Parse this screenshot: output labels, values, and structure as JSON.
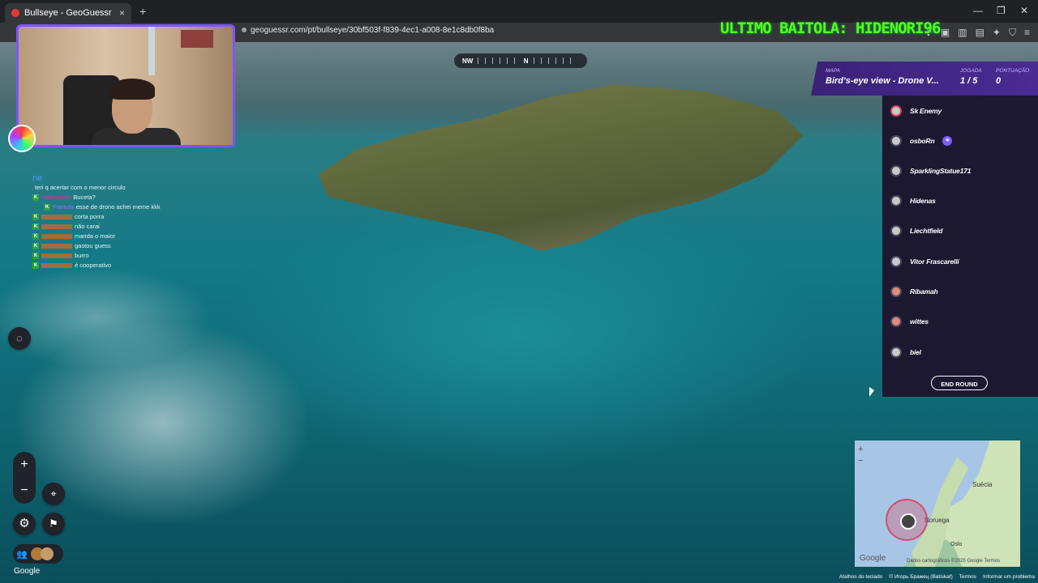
{
  "browser": {
    "tab_title": "Bullseye - GeoGuessr",
    "new_tab": "+",
    "url": "geoguessr.com/pt/bullseye/30bf503f-f839-4ec1-a008-8e1c8db0f8ba"
  },
  "banner": "ULTIMO BAITOLA: HIDENORI96",
  "compass": {
    "left": "NW",
    "center": "N"
  },
  "chat": {
    "header": "ne",
    "messages": [
      {
        "user": "",
        "text": "teri q acertar com o menor circulo"
      },
      {
        "user": "Hidenori96",
        "text": "Buceta?"
      },
      {
        "user": "Pantufa",
        "text": "esse de drono achei meme kkk"
      },
      {
        "user": "",
        "text": "corta porra"
      },
      {
        "user": "",
        "text": "não carai"
      },
      {
        "user": "",
        "text": "manda o maior"
      },
      {
        "user": "",
        "text": "gastou guess"
      },
      {
        "user": "",
        "text": "burro"
      },
      {
        "user": "",
        "text": "é cooperativo"
      }
    ]
  },
  "game_info": {
    "map_label": "MAPA",
    "map_value": "Bird's-eye view - Drone V...",
    "round_label": "JOGADA",
    "round_value": "1 / 5",
    "score_label": "PONTUAÇÃO",
    "score_value": "0"
  },
  "players": [
    {
      "name": "Sk Enemy"
    },
    {
      "name": "osboRn",
      "badge": "★"
    },
    {
      "name": "SparklingStatue171"
    },
    {
      "name": "Hidenas"
    },
    {
      "name": "Liechtfield"
    },
    {
      "name": "Vitor Frascarelli"
    },
    {
      "name": "Ribamah"
    },
    {
      "name": "wittes"
    },
    {
      "name": "biel"
    }
  ],
  "end_round_label": "END ROUND",
  "controls": {
    "zoom_in": "+",
    "zoom_out": "−",
    "google_label": "Google"
  },
  "minimap": {
    "label_suecia": "Suécia",
    "label_noruega": "Noruega",
    "label_oslo": "Oslo",
    "zoom_in": "+",
    "zoom_out": "−",
    "google": "Google",
    "attribution": "Dados cartográficos ©2025 Google   Termos"
  },
  "footer": {
    "shortcuts": "Atalhos do teclado",
    "copyright": "© Игорь Бражец (Batiskaf)",
    "terms": "Termos",
    "report": "Informar um problema"
  }
}
